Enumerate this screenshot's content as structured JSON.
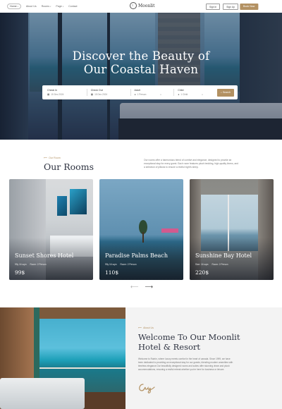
{
  "header": {
    "nav": [
      {
        "label": "Home",
        "has_caret": true,
        "active": true
      },
      {
        "label": "About Us",
        "has_caret": false,
        "active": false
      },
      {
        "label": "Rooms",
        "has_caret": true,
        "active": false
      },
      {
        "label": "Page",
        "has_caret": true,
        "active": false
      },
      {
        "label": "Contact",
        "has_caret": false,
        "active": false
      }
    ],
    "brand": "Moonlit",
    "signin_label": "Sign In",
    "signup_label": "Sign Up",
    "book_now_label": "Book Now"
  },
  "hero": {
    "title_line1": "Discover the Beauty of",
    "title_line2": "Our Coastal Haven"
  },
  "booking": {
    "checkin_label": "Check In",
    "checkin_value": "15 Dec 2024",
    "checkout_label": "Check Out",
    "checkout_value": "15 Dec 2024",
    "adult_label": "Adult",
    "adult_value": "1 Person",
    "child_label": "Child",
    "child_value": "1 Child",
    "search_label": "Search"
  },
  "rooms": {
    "eyebrow": "Our Room",
    "title": "Our Rooms",
    "description": "Our rooms offer a harmonious blend of comfort and elegance, designed to provide an exceptional stay for every guest. Each room features plush bedding, high-quality linens, and a selection of pillows to ensure a restful night's sleep.",
    "cards": [
      {
        "name": "Sunset Shores Hotel",
        "size": "99y 16 sqm",
        "guests": "Room: 2 Person",
        "price": "99$"
      },
      {
        "name": "Paradise Palms Beach",
        "size": "99y 16 sqm",
        "guests": "Room: 2 Person",
        "price": "110$"
      },
      {
        "name": "Sunshine Bay Hotel",
        "size": "Size: 16 sqm",
        "guests": "Room: 2 Person",
        "price": "220$"
      }
    ]
  },
  "about": {
    "eyebrow": "About Us",
    "title_line1": "Welcome To Our Moonlit",
    "title_line2": "Hotel & Resort",
    "text": "Welcome to Rainin, where luxury meets comfort in the heart of canada. Since 1999, we have been dedicated to providing an exceptional stay for our guests, blending modern amenities with timeless elegance.Our beautifully designed rooms and suites offer stunning views and plush accommodations, ensuring a restful retreat whether you're here for business or leisure.",
    "signature": "Cary"
  },
  "colors": {
    "accent": "#b39162",
    "title": "#2d3240",
    "about_bg": "#f3f3f3"
  }
}
